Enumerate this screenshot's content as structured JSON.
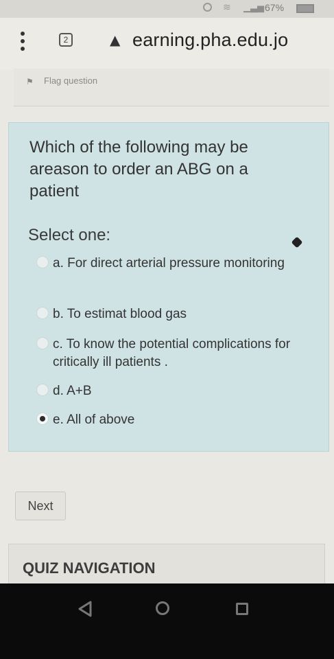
{
  "status_bar": {
    "battery_text": "67%",
    "signal_icon": "signal-bars-icon",
    "wifi_icon": "wifi-icon"
  },
  "browser": {
    "tab_count": "2",
    "url": "earning.pha.edu.jo",
    "url_icon": "warning-triangle-icon"
  },
  "question": {
    "flag_label": "Flag question",
    "text": "Which of the following may be areason to order an ABG on a patient",
    "select_label": "Select one:",
    "options": [
      {
        "label": "a. For direct arterial pressure monitoring",
        "checked": false
      },
      {
        "label": "b. To estimat blood gas",
        "checked": false
      },
      {
        "label": "c. To know the potential complications for critically ill patients .",
        "checked": false
      },
      {
        "label": "d. A+B",
        "checked": false
      },
      {
        "label": "e. All of above",
        "checked": true
      }
    ]
  },
  "actions": {
    "next_label": "Next"
  },
  "quiz_navigation": {
    "title": "QUIZ NAVIGATION"
  },
  "colors": {
    "card_bg": "#cfe2e4",
    "page_bg": "#e9e8e3"
  }
}
